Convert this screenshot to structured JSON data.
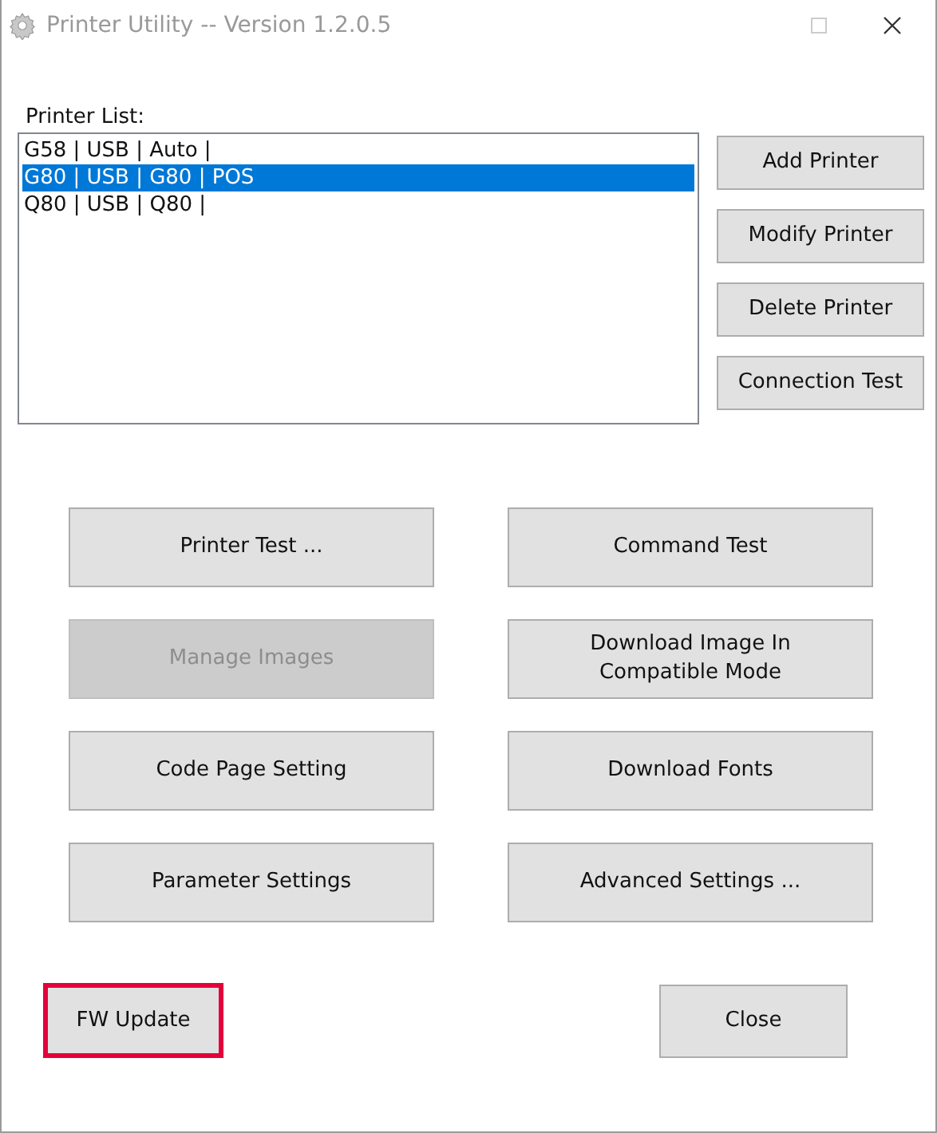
{
  "window": {
    "title": "Printer Utility -- Version 1.2.0.5"
  },
  "printer_list": {
    "label": "Printer List:",
    "items": [
      {
        "text": "G58 | USB | Auto |",
        "selected": false
      },
      {
        "text": "G80 | USB | G80 | POS",
        "selected": true
      },
      {
        "text": "Q80 | USB | Q80 |",
        "selected": false
      }
    ]
  },
  "side_buttons": [
    {
      "label": "Add Printer"
    },
    {
      "label": "Modify Printer"
    },
    {
      "label": "Delete Printer"
    },
    {
      "label": "Connection Test"
    }
  ],
  "function_buttons": [
    {
      "label": "Printer Test ...",
      "disabled": false
    },
    {
      "label": "Manage Images",
      "disabled": true
    },
    {
      "label": "Code Page Setting",
      "disabled": false
    },
    {
      "label": "Parameter Settings",
      "disabled": false
    },
    {
      "label": "Command Test",
      "disabled": false
    },
    {
      "label": "Download Image In Compatible Mode",
      "disabled": false
    },
    {
      "label": "Download Fonts",
      "disabled": false
    },
    {
      "label": "Advanced Settings ...",
      "disabled": false
    }
  ],
  "bottom_buttons": [
    {
      "label": "FW Update",
      "highlighted": true
    },
    {
      "label": "Close",
      "highlighted": false
    }
  ]
}
